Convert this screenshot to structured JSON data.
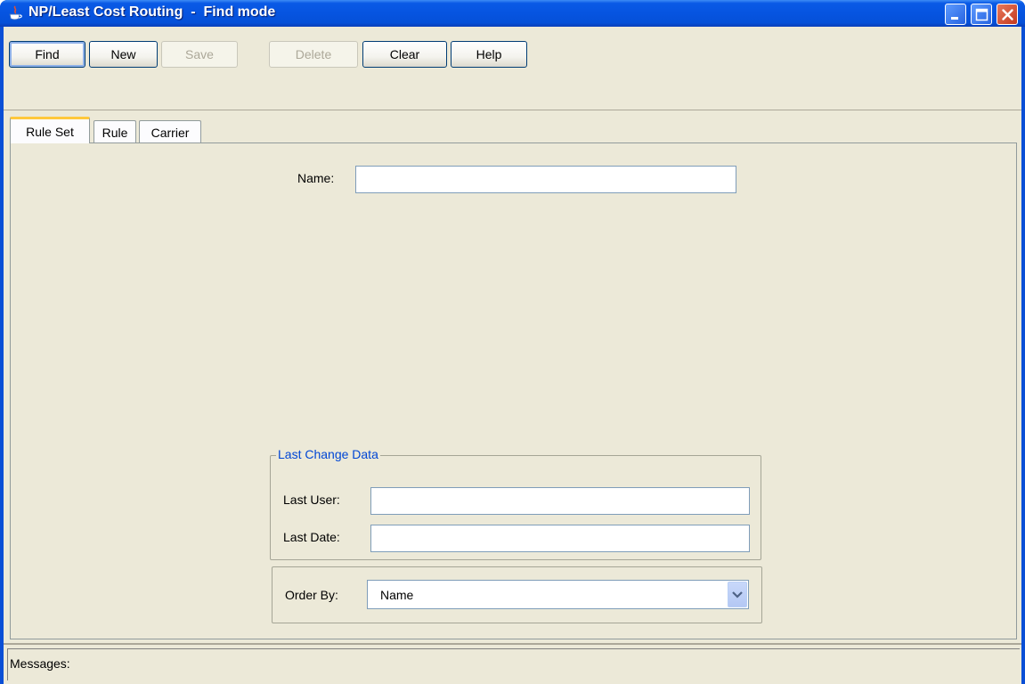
{
  "window": {
    "title": "NP/Least Cost Routing  -  Find mode",
    "accent_color": "#0a5ae6",
    "icon": "java-cup-icon",
    "controls": [
      "minimize-icon",
      "maximize-icon",
      "close-icon"
    ]
  },
  "toolbar": {
    "find_label": "Find",
    "new_label": "New",
    "save_label": "Save",
    "delete_label": "Delete",
    "clear_label": "Clear",
    "help_label": "Help"
  },
  "tabs": {
    "rule_set": "Rule Set",
    "rule": "Rule",
    "carrier": "Carrier",
    "selected": "Rule Set"
  },
  "form": {
    "name_label": "Name:",
    "name_value": "",
    "last_change": {
      "legend": "Last Change Data",
      "last_user_label": "Last User:",
      "last_user_value": "",
      "last_date_label": "Last Date:",
      "last_date_value": ""
    },
    "order_by": {
      "label": "Order By:",
      "selected": "Name"
    }
  },
  "status": {
    "messages_label": "Messages:"
  }
}
